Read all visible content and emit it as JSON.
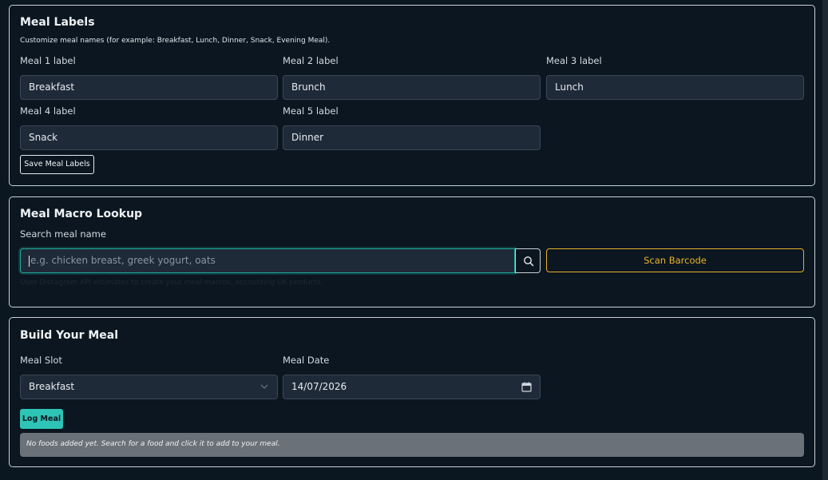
{
  "meal_labels": {
    "title": "Meal Labels",
    "subtitle": "Customize meal names (for example: Breakfast, Lunch, Dinner, Snack, Evening Meal).",
    "fields": [
      {
        "label": "Meal 1 label",
        "value": "Breakfast"
      },
      {
        "label": "Meal 2 label",
        "value": "Brunch"
      },
      {
        "label": "Meal 3 label",
        "value": "Lunch"
      },
      {
        "label": "Meal 4 label",
        "value": "Snack"
      },
      {
        "label": "Meal 5 label",
        "value": "Dinner"
      }
    ],
    "save_label": "Save Meal Labels"
  },
  "lookup": {
    "title": "Meal Macro Lookup",
    "search_label": "Search meal name",
    "search_placeholder": "e.g. chicken breast, greek yogurt, oats",
    "search_icon": "search-icon",
    "scan_label": "Scan Barcode",
    "hint": "Uses Dietagram API estimates to create your meal macros, accounting UK products.",
    "accent_color": "#e5b02a"
  },
  "build": {
    "title": "Build Your Meal",
    "slot_label": "Meal Slot",
    "slot_value": "Breakfast",
    "date_label": "Meal Date",
    "date_value": "14/07/2026",
    "log_label": "Log Meal",
    "empty_note": "No foods added yet. Search for a food and click it to add to your meal.",
    "accent_color": "#2ec4b6"
  }
}
